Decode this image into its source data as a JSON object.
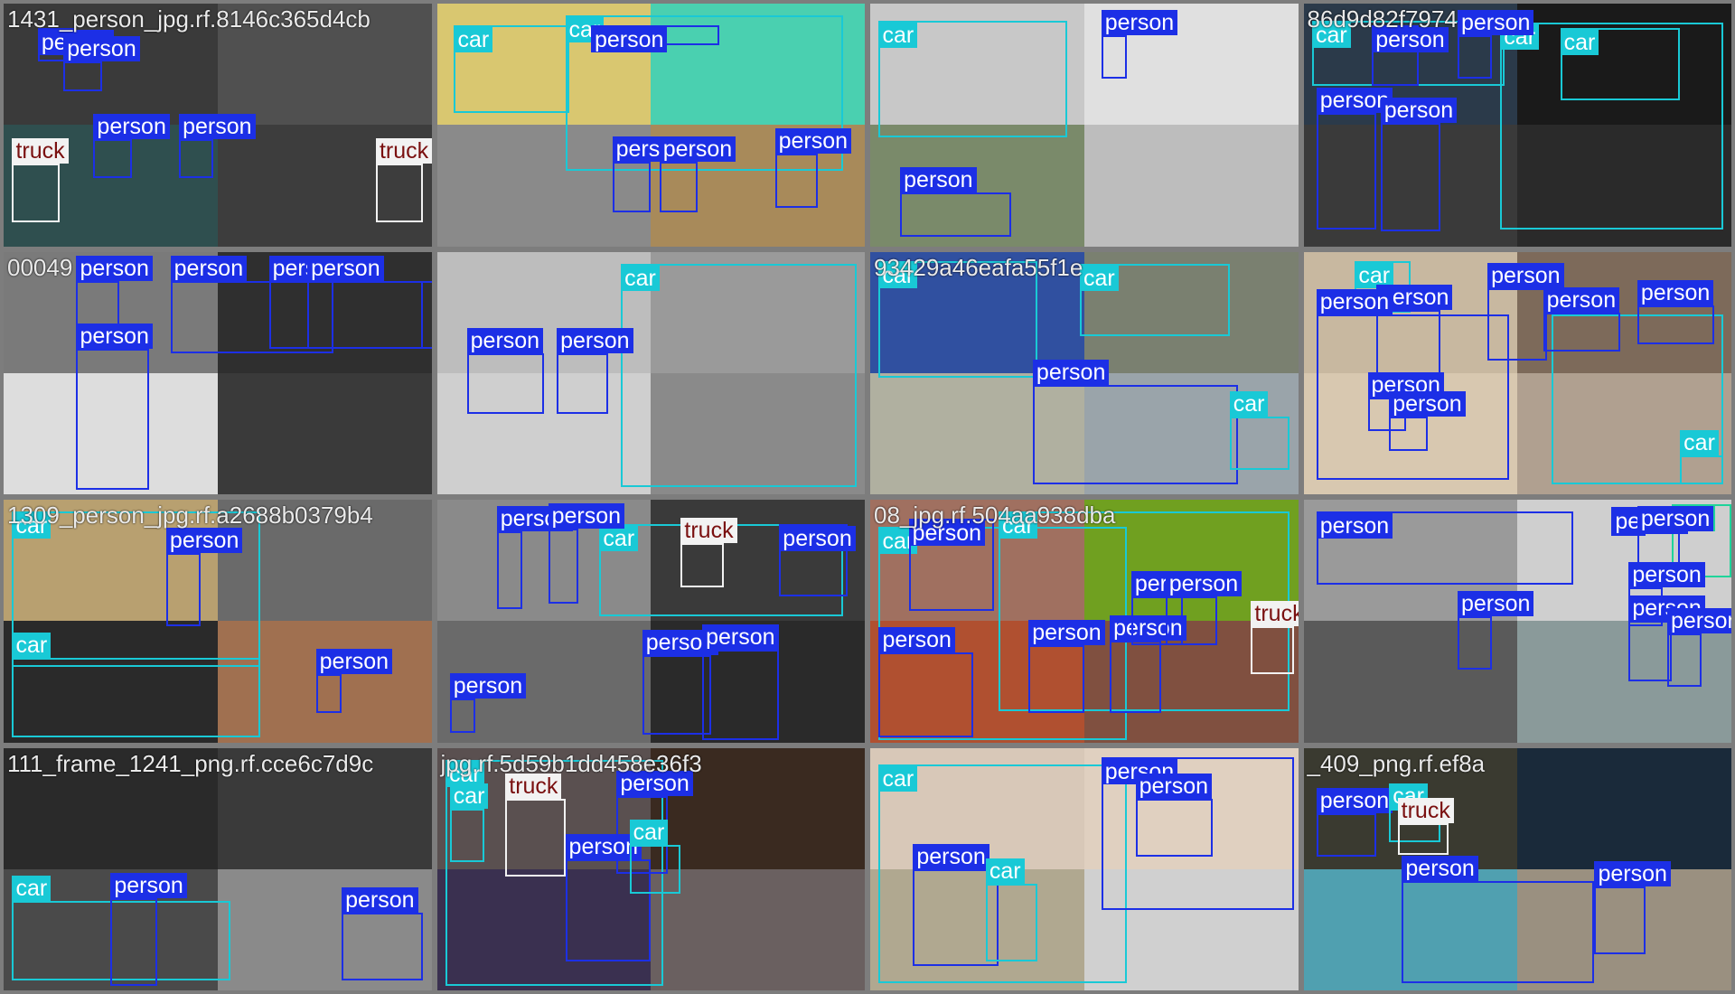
{
  "colors": {
    "person": "#1c2fe6",
    "car": "#19c9d6",
    "truck": "#f2f2f2",
    "bus": "#1fd49a"
  },
  "tiles": [
    {
      "filename": "1431_person_jpg.rf.8146c365d4cb",
      "quads": [
        "#3a3a3a",
        "#505050",
        "#2f4f4f",
        "#3d3d3d"
      ],
      "boxes": [
        {
          "cls": "person",
          "label": "person"
        },
        {
          "cls": "person",
          "label": "person"
        },
        {
          "cls": "person",
          "label": "person"
        },
        {
          "cls": "person",
          "label": "person"
        },
        {
          "cls": "truck",
          "label": "truck"
        },
        {
          "cls": "truck",
          "label": "truck"
        }
      ]
    },
    {
      "filename": "",
      "quads": [
        "#d9c770",
        "#4ad0b0",
        "#8a8a8a",
        "#a88a5a"
      ],
      "boxes": [
        {
          "cls": "car",
          "label": "car"
        },
        {
          "cls": "car",
          "label": "car"
        },
        {
          "cls": "person",
          "label": "person"
        },
        {
          "cls": "person",
          "label": "person"
        },
        {
          "cls": "person",
          "label": "person"
        },
        {
          "cls": "person",
          "label": "person"
        }
      ]
    },
    {
      "filename": "",
      "quads": [
        "#c8c8c8",
        "#e0e0e0",
        "#7a8a6a",
        "#bdbdbd"
      ],
      "boxes": [
        {
          "cls": "car",
          "label": "car"
        },
        {
          "cls": "person",
          "label": "person"
        },
        {
          "cls": "person",
          "label": "person"
        }
      ]
    },
    {
      "filename": "86d9d82f7974",
      "quads": [
        "#2b3a4a",
        "#1a1a1a",
        "#3a3a3a",
        "#2a2a2a"
      ],
      "boxes": [
        {
          "cls": "car",
          "label": "car"
        },
        {
          "cls": "car",
          "label": "car"
        },
        {
          "cls": "person",
          "label": "person"
        },
        {
          "cls": "person",
          "label": "person"
        },
        {
          "cls": "car",
          "label": "car"
        },
        {
          "cls": "person",
          "label": "person"
        },
        {
          "cls": "person",
          "label": "person"
        }
      ]
    },
    {
      "filename": "00049",
      "quads": [
        "#7a7a7a",
        "#2f2f2f",
        "#dddddd",
        "#3a3a3a"
      ],
      "boxes": [
        {
          "cls": "person",
          "label": "person"
        },
        {
          "cls": "person",
          "label": "person"
        },
        {
          "cls": "person",
          "label": "person"
        },
        {
          "cls": "person",
          "label": "person"
        },
        {
          "cls": "person",
          "label": "person"
        }
      ]
    },
    {
      "filename": "",
      "quads": [
        "#bdbdbd",
        "#9a9a9a",
        "#cfcfcf",
        "#8a8a8a"
      ],
      "boxes": [
        {
          "cls": "car",
          "label": "car"
        },
        {
          "cls": "person",
          "label": "person"
        },
        {
          "cls": "person",
          "label": "person"
        }
      ]
    },
    {
      "filename": "93429a46eafa55f1e",
      "quads": [
        "#3050a0",
        "#7a8070",
        "#b0b0a0",
        "#9aa4aa"
      ],
      "boxes": [
        {
          "cls": "car",
          "label": "car"
        },
        {
          "cls": "car",
          "label": "car"
        },
        {
          "cls": "person",
          "label": "person"
        },
        {
          "cls": "car",
          "label": "car"
        },
        {
          "cls": "person",
          "label": "person"
        }
      ]
    },
    {
      "filename": "",
      "quads": [
        "#c8b8a0",
        "#7d6a5a",
        "#d8c8b0",
        "#b0a090"
      ],
      "boxes": [
        {
          "cls": "car",
          "label": "car"
        },
        {
          "cls": "person",
          "label": "person"
        },
        {
          "cls": "person",
          "label": "person"
        },
        {
          "cls": "person",
          "label": "person"
        },
        {
          "cls": "car",
          "label": "car"
        },
        {
          "cls": "person",
          "label": "person"
        },
        {
          "cls": "person",
          "label": "person"
        },
        {
          "cls": "person",
          "label": "person"
        },
        {
          "cls": "person",
          "label": "person"
        },
        {
          "cls": "car",
          "label": "car"
        }
      ]
    },
    {
      "filename": "1309_person_jpg.rf.a2688b0379b4",
      "quads": [
        "#b8a070",
        "#6a6a6a",
        "#2a2a2a",
        "#a07050"
      ],
      "boxes": [
        {
          "cls": "car",
          "label": "car"
        },
        {
          "cls": "person",
          "label": "person"
        },
        {
          "cls": "car",
          "label": "car"
        },
        {
          "cls": "person",
          "label": "person"
        }
      ]
    },
    {
      "filename": "",
      "quads": [
        "#8a8a8a",
        "#3a3a3a",
        "#6a6a6a",
        "#2a2a2a"
      ],
      "boxes": [
        {
          "cls": "person",
          "label": "person"
        },
        {
          "cls": "car",
          "label": "car"
        },
        {
          "cls": "person",
          "label": "person"
        },
        {
          "cls": "truck",
          "label": "truck"
        },
        {
          "cls": "person",
          "label": "person"
        },
        {
          "cls": "person",
          "label": "person"
        },
        {
          "cls": "person",
          "label": "person"
        },
        {
          "cls": "person",
          "label": "person"
        }
      ]
    },
    {
      "filename": "08_jpg.rf.504aa938dba",
      "quads": [
        "#a07060",
        "#70a020",
        "#b05030",
        "#805040"
      ],
      "boxes": [
        {
          "cls": "car",
          "label": "car"
        },
        {
          "cls": "car",
          "label": "car"
        },
        {
          "cls": "person",
          "label": "person"
        },
        {
          "cls": "person",
          "label": "person"
        },
        {
          "cls": "person",
          "label": "person"
        },
        {
          "cls": "person",
          "label": "person"
        },
        {
          "cls": "truck",
          "label": "truck"
        },
        {
          "cls": "person",
          "label": "person"
        },
        {
          "cls": "person",
          "label": "person"
        }
      ]
    },
    {
      "filename": "",
      "quads": [
        "#9a9a9a",
        "#cfcfcf",
        "#5a5a5a",
        "#8a9a9a"
      ],
      "boxes": [
        {
          "cls": "person",
          "label": "person"
        },
        {
          "cls": "bus",
          "label": "bus"
        },
        {
          "cls": "person",
          "label": "person"
        },
        {
          "cls": "person",
          "label": "person"
        },
        {
          "cls": "person",
          "label": "person"
        },
        {
          "cls": "person",
          "label": "person"
        },
        {
          "cls": "person",
          "label": "person"
        },
        {
          "cls": "person",
          "label": "person"
        }
      ]
    },
    {
      "filename": "111_frame_1241_png.rf.cce6c7d9c",
      "quads": [
        "#2a2a2a",
        "#3a3a3a",
        "#4a4a4a",
        "#8a8a8a"
      ],
      "boxes": [
        {
          "cls": "car",
          "label": "car"
        },
        {
          "cls": "person",
          "label": "person"
        },
        {
          "cls": "person",
          "label": "person"
        }
      ]
    },
    {
      "filename": "jpg.rf.5d59b1dd458e36f3",
      "quads": [
        "#5a5050",
        "#3a2a20",
        "#3a3050",
        "#6a6060"
      ],
      "boxes": [
        {
          "cls": "car",
          "label": "car"
        },
        {
          "cls": "car",
          "label": "car"
        },
        {
          "cls": "truck",
          "label": "truck"
        },
        {
          "cls": "person",
          "label": "person"
        },
        {
          "cls": "person",
          "label": "person"
        },
        {
          "cls": "car",
          "label": "car"
        }
      ]
    },
    {
      "filename": "",
      "quads": [
        "#d8c8b8",
        "#e0d0c0",
        "#b0a890",
        "#d0d0d0"
      ],
      "boxes": [
        {
          "cls": "car",
          "label": "car"
        },
        {
          "cls": "person",
          "label": "person"
        },
        {
          "cls": "person",
          "label": "person"
        },
        {
          "cls": "person",
          "label": "person"
        },
        {
          "cls": "car",
          "label": "car"
        }
      ]
    },
    {
      "filename": "_409_png.rf.ef8a",
      "quads": [
        "#3a3a30",
        "#1a2a3a",
        "#50a0b0",
        "#9a9080"
      ],
      "boxes": [
        {
          "cls": "person",
          "label": "person"
        },
        {
          "cls": "car",
          "label": "car"
        },
        {
          "cls": "truck",
          "label": "truck"
        },
        {
          "cls": "person",
          "label": "person"
        },
        {
          "cls": "person",
          "label": "person"
        }
      ]
    }
  ]
}
